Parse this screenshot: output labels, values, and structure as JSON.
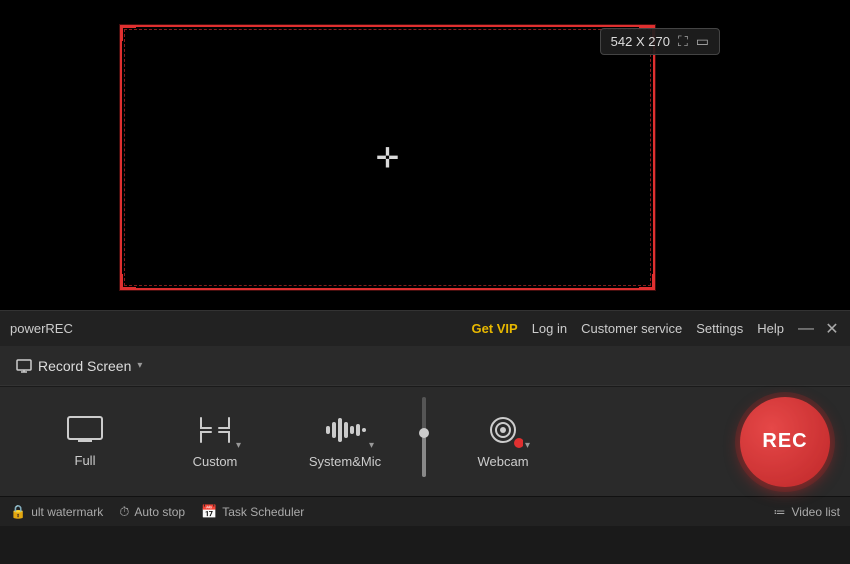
{
  "app": {
    "name": "powerREC",
    "title_bar": {
      "get_vip": "Get VIP",
      "login": "Log in",
      "customer_service": "Customer service",
      "settings": "Settings",
      "help": "Help",
      "minimize": "—",
      "close": "✕"
    }
  },
  "toolbar": {
    "record_screen": "Record Screen",
    "dropdown_label": "▾"
  },
  "preview": {
    "dimensions": "542 X 270"
  },
  "controls": [
    {
      "id": "full",
      "label": "Full",
      "icon": "monitor"
    },
    {
      "id": "custom",
      "label": "Custom",
      "icon": "crop"
    },
    {
      "id": "system_mic",
      "label": "System&Mic",
      "icon": "audio"
    },
    {
      "id": "webcam",
      "label": "Webcam",
      "icon": "webcam"
    }
  ],
  "rec_button": {
    "label": "REC"
  },
  "status_bar": {
    "watermark": "ult watermark",
    "auto_stop": "Auto stop",
    "task_scheduler": "Task Scheduler",
    "video_list": "Video list"
  }
}
